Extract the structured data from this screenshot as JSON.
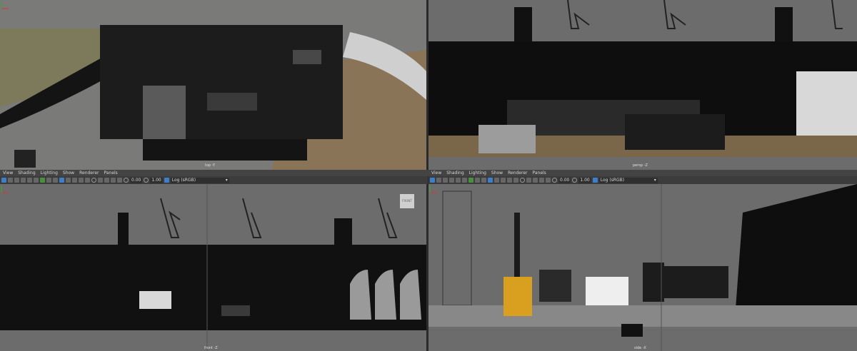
{
  "viewports": {
    "top": {
      "camera": "top -Y"
    },
    "persp": {
      "camera": "persp -Z"
    },
    "front": {
      "camera": "front -Z",
      "view_cube": "FRONT"
    },
    "side": {
      "camera": "side -X"
    }
  },
  "panel_menu": [
    "View",
    "Shading",
    "Lighting",
    "Show",
    "Renderer",
    "Panels"
  ],
  "toolbar": {
    "exposure": "0.00",
    "gamma": "1.00",
    "color_space": "Log (sRGB)"
  },
  "colors": {
    "viewport_bg": "#6c6c6c",
    "menu_bg": "#444444",
    "toolbar_bg": "#3c3c3c",
    "ground": "#8a7458"
  }
}
